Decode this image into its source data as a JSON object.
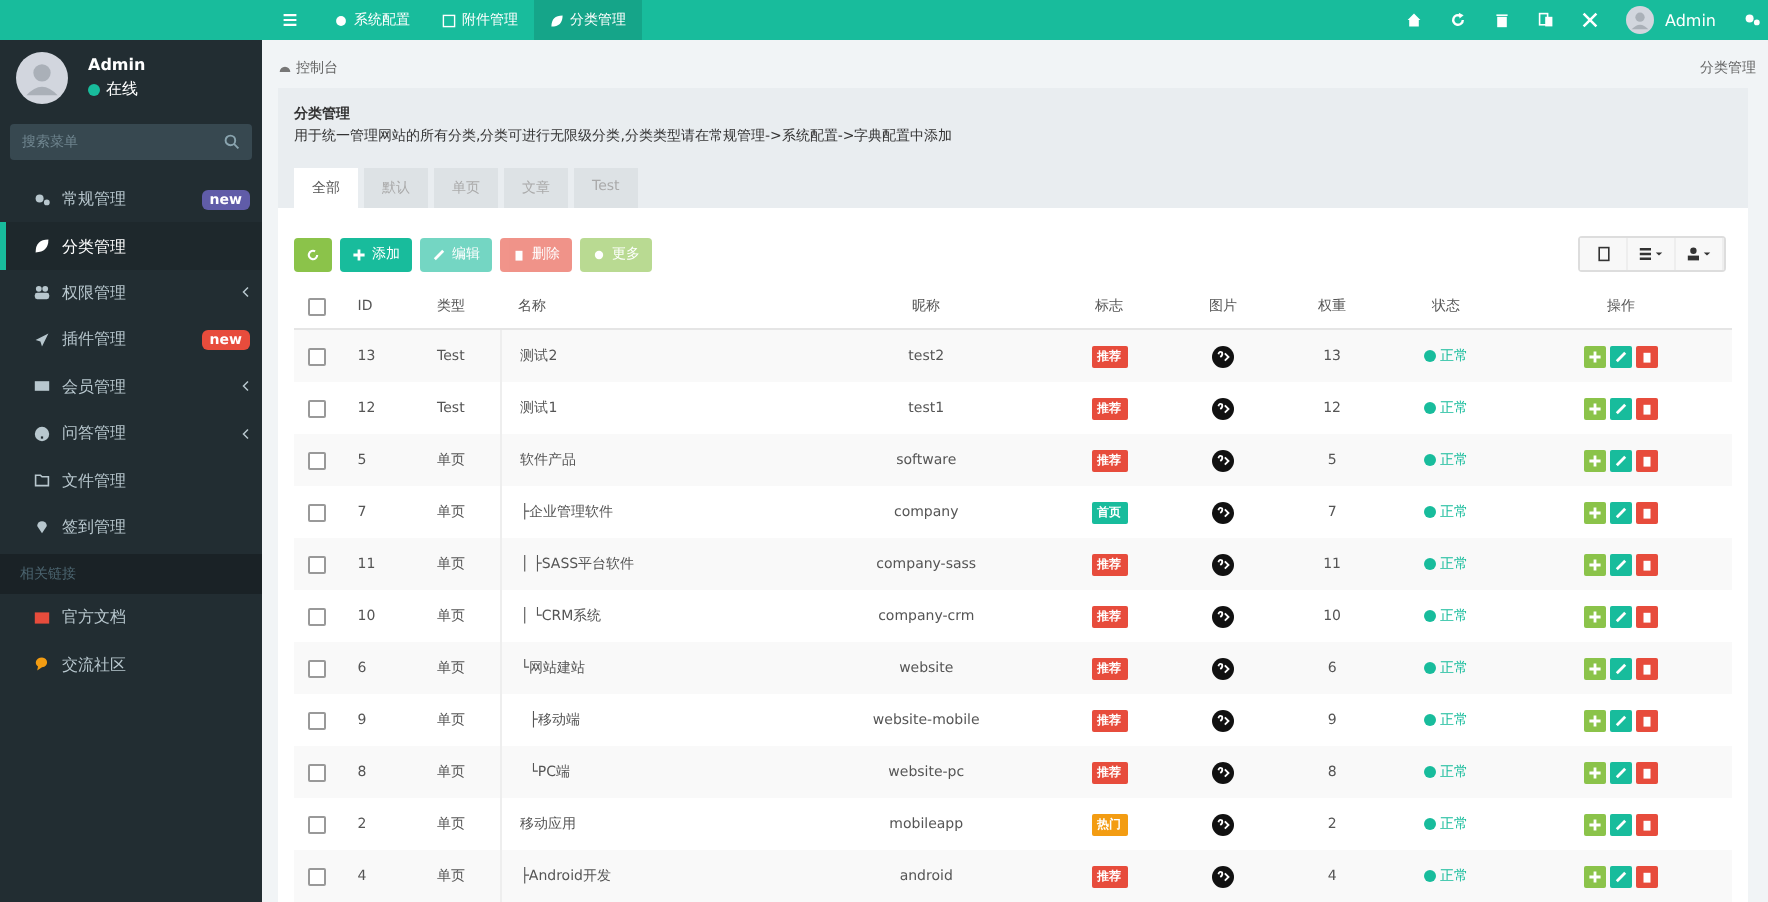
{
  "user": {
    "name": "Admin",
    "status": "在线"
  },
  "sidebar": {
    "search": {
      "placeholder": "搜索菜单"
    },
    "items": [
      {
        "label": "常规管理",
        "badge": {
          "label": "new",
          "color": "#605ca8"
        },
        "caret": false,
        "selected": false
      },
      {
        "label": "分类管理",
        "caret": false,
        "selected": true
      },
      {
        "label": "权限管理",
        "caret": true,
        "selected": false
      },
      {
        "label": "插件管理",
        "badge": {
          "label": "new",
          "color": "#e74c3c"
        },
        "caret": false,
        "selected": false
      },
      {
        "label": "会员管理",
        "caret": true,
        "selected": false
      },
      {
        "label": "问答管理",
        "caret": true,
        "selected": false
      },
      {
        "label": "文件管理",
        "caret": false,
        "selected": false
      },
      {
        "label": "签到管理",
        "caret": false,
        "selected": false
      }
    ],
    "section": "相关链接",
    "links": [
      {
        "label": "官方文档",
        "color": "#e74c3c"
      },
      {
        "label": "交流社区",
        "color": "#f39c12"
      }
    ]
  },
  "topnav": {
    "tabs": [
      {
        "label": "系统配置",
        "selected": false
      },
      {
        "label": "附件管理",
        "selected": false
      },
      {
        "label": "分类管理",
        "selected": true
      }
    ],
    "user": "Admin"
  },
  "breadcrumb": "控制台",
  "page_title_right": "分类管理",
  "panel": {
    "title": "分类管理",
    "description": "用于统一管理网站的所有分类,分类可进行无限级分类,分类类型请在常规管理->系统配置->字典配置中添加",
    "tabs": [
      {
        "label": "全部",
        "selected": true
      },
      {
        "label": "默认",
        "selected": false
      },
      {
        "label": "单页",
        "selected": false
      },
      {
        "label": "文章",
        "selected": false
      },
      {
        "label": "Test",
        "selected": false
      }
    ]
  },
  "toolbar": [
    {
      "kind": "refresh",
      "disabled": false
    },
    {
      "kind": "add",
      "label": "添加",
      "disabled": false
    },
    {
      "kind": "edit",
      "label": "编辑",
      "disabled": true
    },
    {
      "kind": "delete",
      "label": "删除",
      "disabled": true
    },
    {
      "kind": "more",
      "label": "更多",
      "disabled": true
    }
  ],
  "table": {
    "select_all_checked": false,
    "columns": [
      "ID",
      "类型",
      "名称",
      "昵称",
      "标志",
      "图片",
      "权重",
      "状态",
      "操作"
    ],
    "rows": [
      {
        "id": "13",
        "type": "Test",
        "name": "测试2",
        "nickname": "test2",
        "flag": {
          "label": "推荐",
          "color": "#e74c3c"
        },
        "weight": "13",
        "status": "正常",
        "checked": false
      },
      {
        "id": "12",
        "type": "Test",
        "name": "测试1",
        "nickname": "test1",
        "flag": {
          "label": "推荐",
          "color": "#e74c3c"
        },
        "weight": "12",
        "status": "正常",
        "checked": false
      },
      {
        "id": "5",
        "type": "单页",
        "name": "软件产品",
        "nickname": "software",
        "flag": {
          "label": "推荐",
          "color": "#e74c3c"
        },
        "weight": "5",
        "status": "正常",
        "checked": false
      },
      {
        "id": "7",
        "type": "单页",
        "name": "├企业管理软件",
        "nickname": "company",
        "flag": {
          "label": "首页",
          "color": "#18bc9c"
        },
        "weight": "7",
        "status": "正常",
        "checked": false
      },
      {
        "id": "11",
        "type": "单页",
        "name": "│ ├SASS平台软件",
        "nickname": "company-sass",
        "flag": {
          "label": "推荐",
          "color": "#e74c3c"
        },
        "weight": "11",
        "status": "正常",
        "checked": false
      },
      {
        "id": "10",
        "type": "单页",
        "name": "│ └CRM系统",
        "nickname": "company-crm",
        "flag": {
          "label": "推荐",
          "color": "#e74c3c"
        },
        "weight": "10",
        "status": "正常",
        "checked": false
      },
      {
        "id": "6",
        "type": "单页",
        "name": "└网站建站",
        "nickname": "website",
        "flag": {
          "label": "推荐",
          "color": "#e74c3c"
        },
        "weight": "6",
        "status": "正常",
        "checked": false
      },
      {
        "id": "9",
        "type": "单页",
        "name": "  ├移动端",
        "nickname": "website-mobile",
        "flag": {
          "label": "推荐",
          "color": "#e74c3c"
        },
        "weight": "9",
        "status": "正常",
        "checked": false
      },
      {
        "id": "8",
        "type": "单页",
        "name": "  └PC端",
        "nickname": "website-pc",
        "flag": {
          "label": "推荐",
          "color": "#e74c3c"
        },
        "weight": "8",
        "status": "正常",
        "checked": false
      },
      {
        "id": "2",
        "type": "单页",
        "name": "移动应用",
        "nickname": "mobileapp",
        "flag": {
          "label": "热门",
          "color": "#f39c12"
        },
        "weight": "2",
        "status": "正常",
        "checked": false
      },
      {
        "id": "4",
        "type": "单页",
        "name": "├Android开发",
        "nickname": "android",
        "flag": {
          "label": "推荐",
          "color": "#e74c3c"
        },
        "weight": "4",
        "status": "正常",
        "checked": false
      }
    ]
  }
}
